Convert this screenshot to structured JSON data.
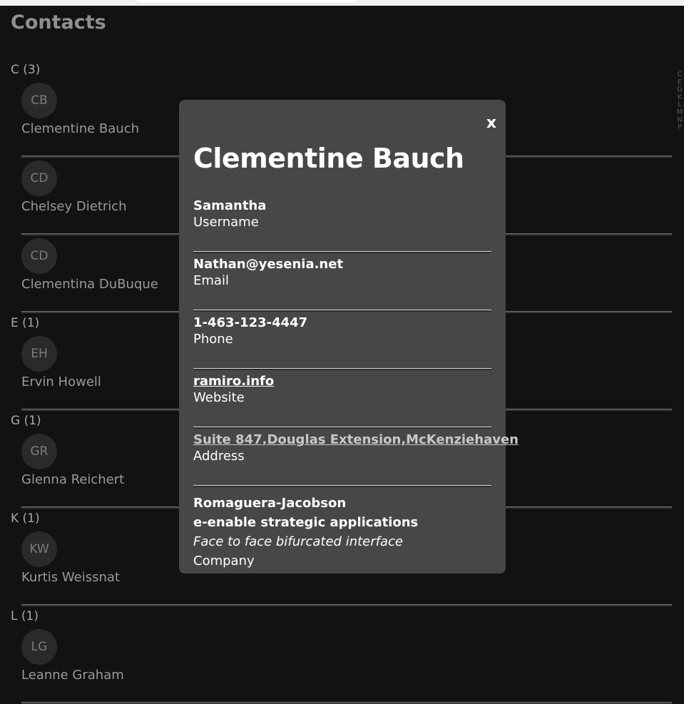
{
  "page": {
    "title": "Contacts"
  },
  "sections": [
    {
      "header": "C (3)",
      "contacts": [
        {
          "initials": "CB",
          "name": "Clementine Bauch"
        },
        {
          "initials": "CD",
          "name": "Chelsey Dietrich"
        },
        {
          "initials": "CD",
          "name": "Clementina DuBuque"
        }
      ]
    },
    {
      "header": "E (1)",
      "contacts": [
        {
          "initials": "EH",
          "name": "Ervin Howell"
        }
      ]
    },
    {
      "header": "G (1)",
      "contacts": [
        {
          "initials": "GR",
          "name": "Glenna Reichert"
        }
      ]
    },
    {
      "header": "K (1)",
      "contacts": [
        {
          "initials": "KW",
          "name": "Kurtis Weissnat"
        }
      ]
    },
    {
      "header": "L (1)",
      "contacts": [
        {
          "initials": "LG",
          "name": "Leanne Graham"
        }
      ]
    }
  ],
  "alpha_index": [
    "C",
    "E",
    "G",
    "K",
    "L",
    "M",
    "N",
    "P"
  ],
  "modal": {
    "close_label": "x",
    "name": "Clementine Bauch",
    "username": {
      "value": "Samantha",
      "label": "Username"
    },
    "email": {
      "value": "Nathan@yesenia.net",
      "label": "Email"
    },
    "phone": {
      "value": "1-463-123-4447",
      "label": "Phone"
    },
    "website": {
      "value": "ramiro.info",
      "label": "Website"
    },
    "address": {
      "value": "Suite 847,Douglas Extension,McKenziehaven",
      "label": "Address"
    },
    "company": {
      "name": "Romaguera-Jacobson",
      "bs": "e-enable strategic applications",
      "catch_phrase": "Face to face bifurcated interface",
      "label": "Company"
    }
  },
  "colors": {
    "background": "#121212",
    "modal_background": "#474747",
    "avatar_background": "#2a2a2a"
  }
}
